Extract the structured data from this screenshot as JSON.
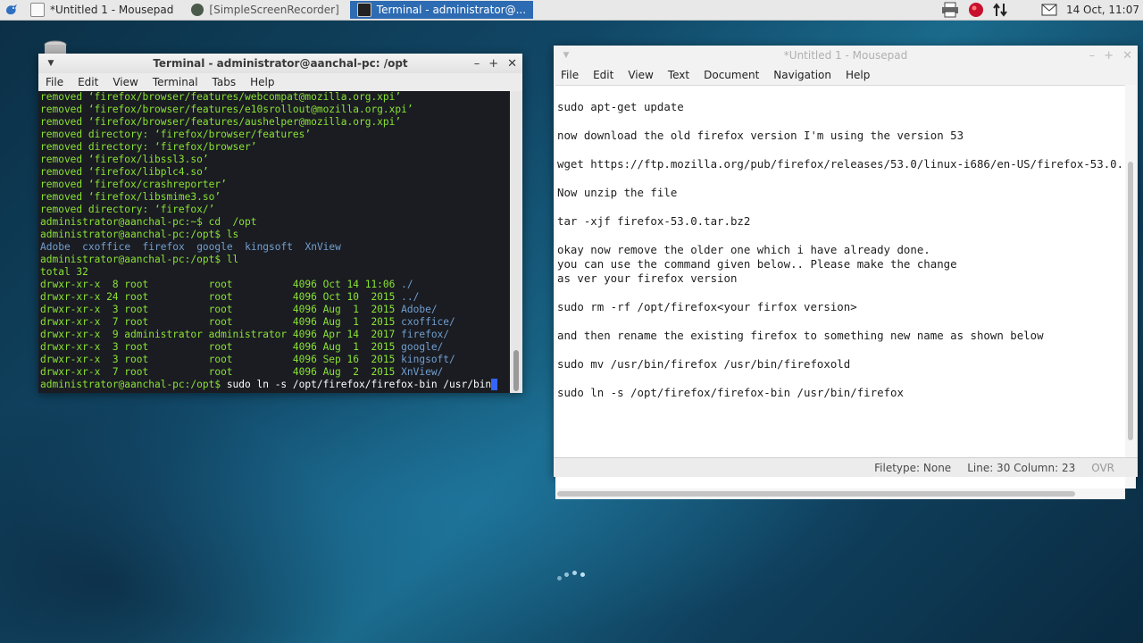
{
  "panel": {
    "tasks": [
      {
        "label": "*Untitled 1 - Mousepad"
      },
      {
        "label": "[SimpleScreenRecorder]"
      },
      {
        "label": "Terminal - administrator@..."
      }
    ],
    "clock": "14 Oct, 11:07"
  },
  "terminal": {
    "title": "Terminal - administrator@aanchal-pc: /opt",
    "menu": [
      "File",
      "Edit",
      "View",
      "Terminal",
      "Tabs",
      "Help"
    ],
    "lines": [
      "removed ‘firefox/browser/features/webcompat@mozilla.org.xpi’",
      "removed ‘firefox/browser/features/e10srollout@mozilla.org.xpi’",
      "removed ‘firefox/browser/features/aushelper@mozilla.org.xpi’",
      "removed directory: ‘firefox/browser/features’",
      "removed directory: ‘firefox/browser’",
      "removed ‘firefox/libssl3.so’",
      "removed ‘firefox/libplc4.so’",
      "removed ‘firefox/crashreporter’",
      "removed ‘firefox/libsmime3.so’",
      "removed directory: ‘firefox/’",
      "administrator@aanchal-pc:~$ cd  /opt",
      "administrator@aanchal-pc:/opt$ ls"
    ],
    "ls_output": [
      "Adobe",
      "cxoffice",
      "firefox",
      "google",
      "kingsoft",
      "XnView"
    ],
    "ll_prompt": "administrator@aanchal-pc:/opt$ ll",
    "total": "total 32",
    "ll_rows": [
      {
        "meta": "drwxr-xr-x  8 root          root          4096 Oct 14 11:06 ",
        "name": "./"
      },
      {
        "meta": "drwxr-xr-x 24 root          root          4096 Oct 10  2015 ",
        "name": "../"
      },
      {
        "meta": "drwxr-xr-x  3 root          root          4096 Aug  1  2015 ",
        "name": "Adobe/"
      },
      {
        "meta": "drwxr-xr-x  7 root          root          4096 Aug  1  2015 ",
        "name": "cxoffice/"
      },
      {
        "meta": "drwxr-xr-x  9 administrator administrator 4096 Apr 14  2017 ",
        "name": "firefox/"
      },
      {
        "meta": "drwxr-xr-x  3 root          root          4096 Aug  1  2015 ",
        "name": "google/"
      },
      {
        "meta": "drwxr-xr-x  3 root          root          4096 Sep 16  2015 ",
        "name": "kingsoft/"
      },
      {
        "meta": "drwxr-xr-x  7 root          root          4096 Aug  2  2015 ",
        "name": "XnView/"
      }
    ],
    "current_prompt": "administrator@aanchal-pc:/opt$ ",
    "current_command": "sudo ln -s /opt/firefox/firefox-bin /usr/bin"
  },
  "mousepad": {
    "title": "*Untitled 1 - Mousepad",
    "menu": [
      "File",
      "Edit",
      "View",
      "Text",
      "Document",
      "Navigation",
      "Help"
    ],
    "lines": [
      "",
      "sudo apt-get update",
      "",
      "now download the old firefox version I'm using the version 53",
      "",
      "wget https://ftp.mozilla.org/pub/firefox/releases/53.0/linux-i686/en-US/firefox-53.0.",
      "",
      "Now unzip the file",
      "",
      "tar -xjf firefox-53.0.tar.bz2",
      "",
      "okay now remove the older one which i have already done.",
      "you can use the command given below.. Please make the change",
      "as ver your firefox version",
      "",
      "sudo rm -rf /opt/firefox<your firfox version>",
      "",
      "and then rename the existing firefox to something new name as shown below",
      "",
      "sudo mv /usr/bin/firefox /usr/bin/firefoxold",
      "",
      "sudo ln -s /opt/firefox/firefox-bin /usr/bin/firefox"
    ],
    "status": {
      "filetype": "Filetype: None",
      "position": "Line: 30 Column: 23",
      "mode": "OVR"
    }
  },
  "colors": {
    "terminal_green": "#8ae234",
    "terminal_blue": "#729fcf",
    "active_task": "#2d6bb3"
  }
}
